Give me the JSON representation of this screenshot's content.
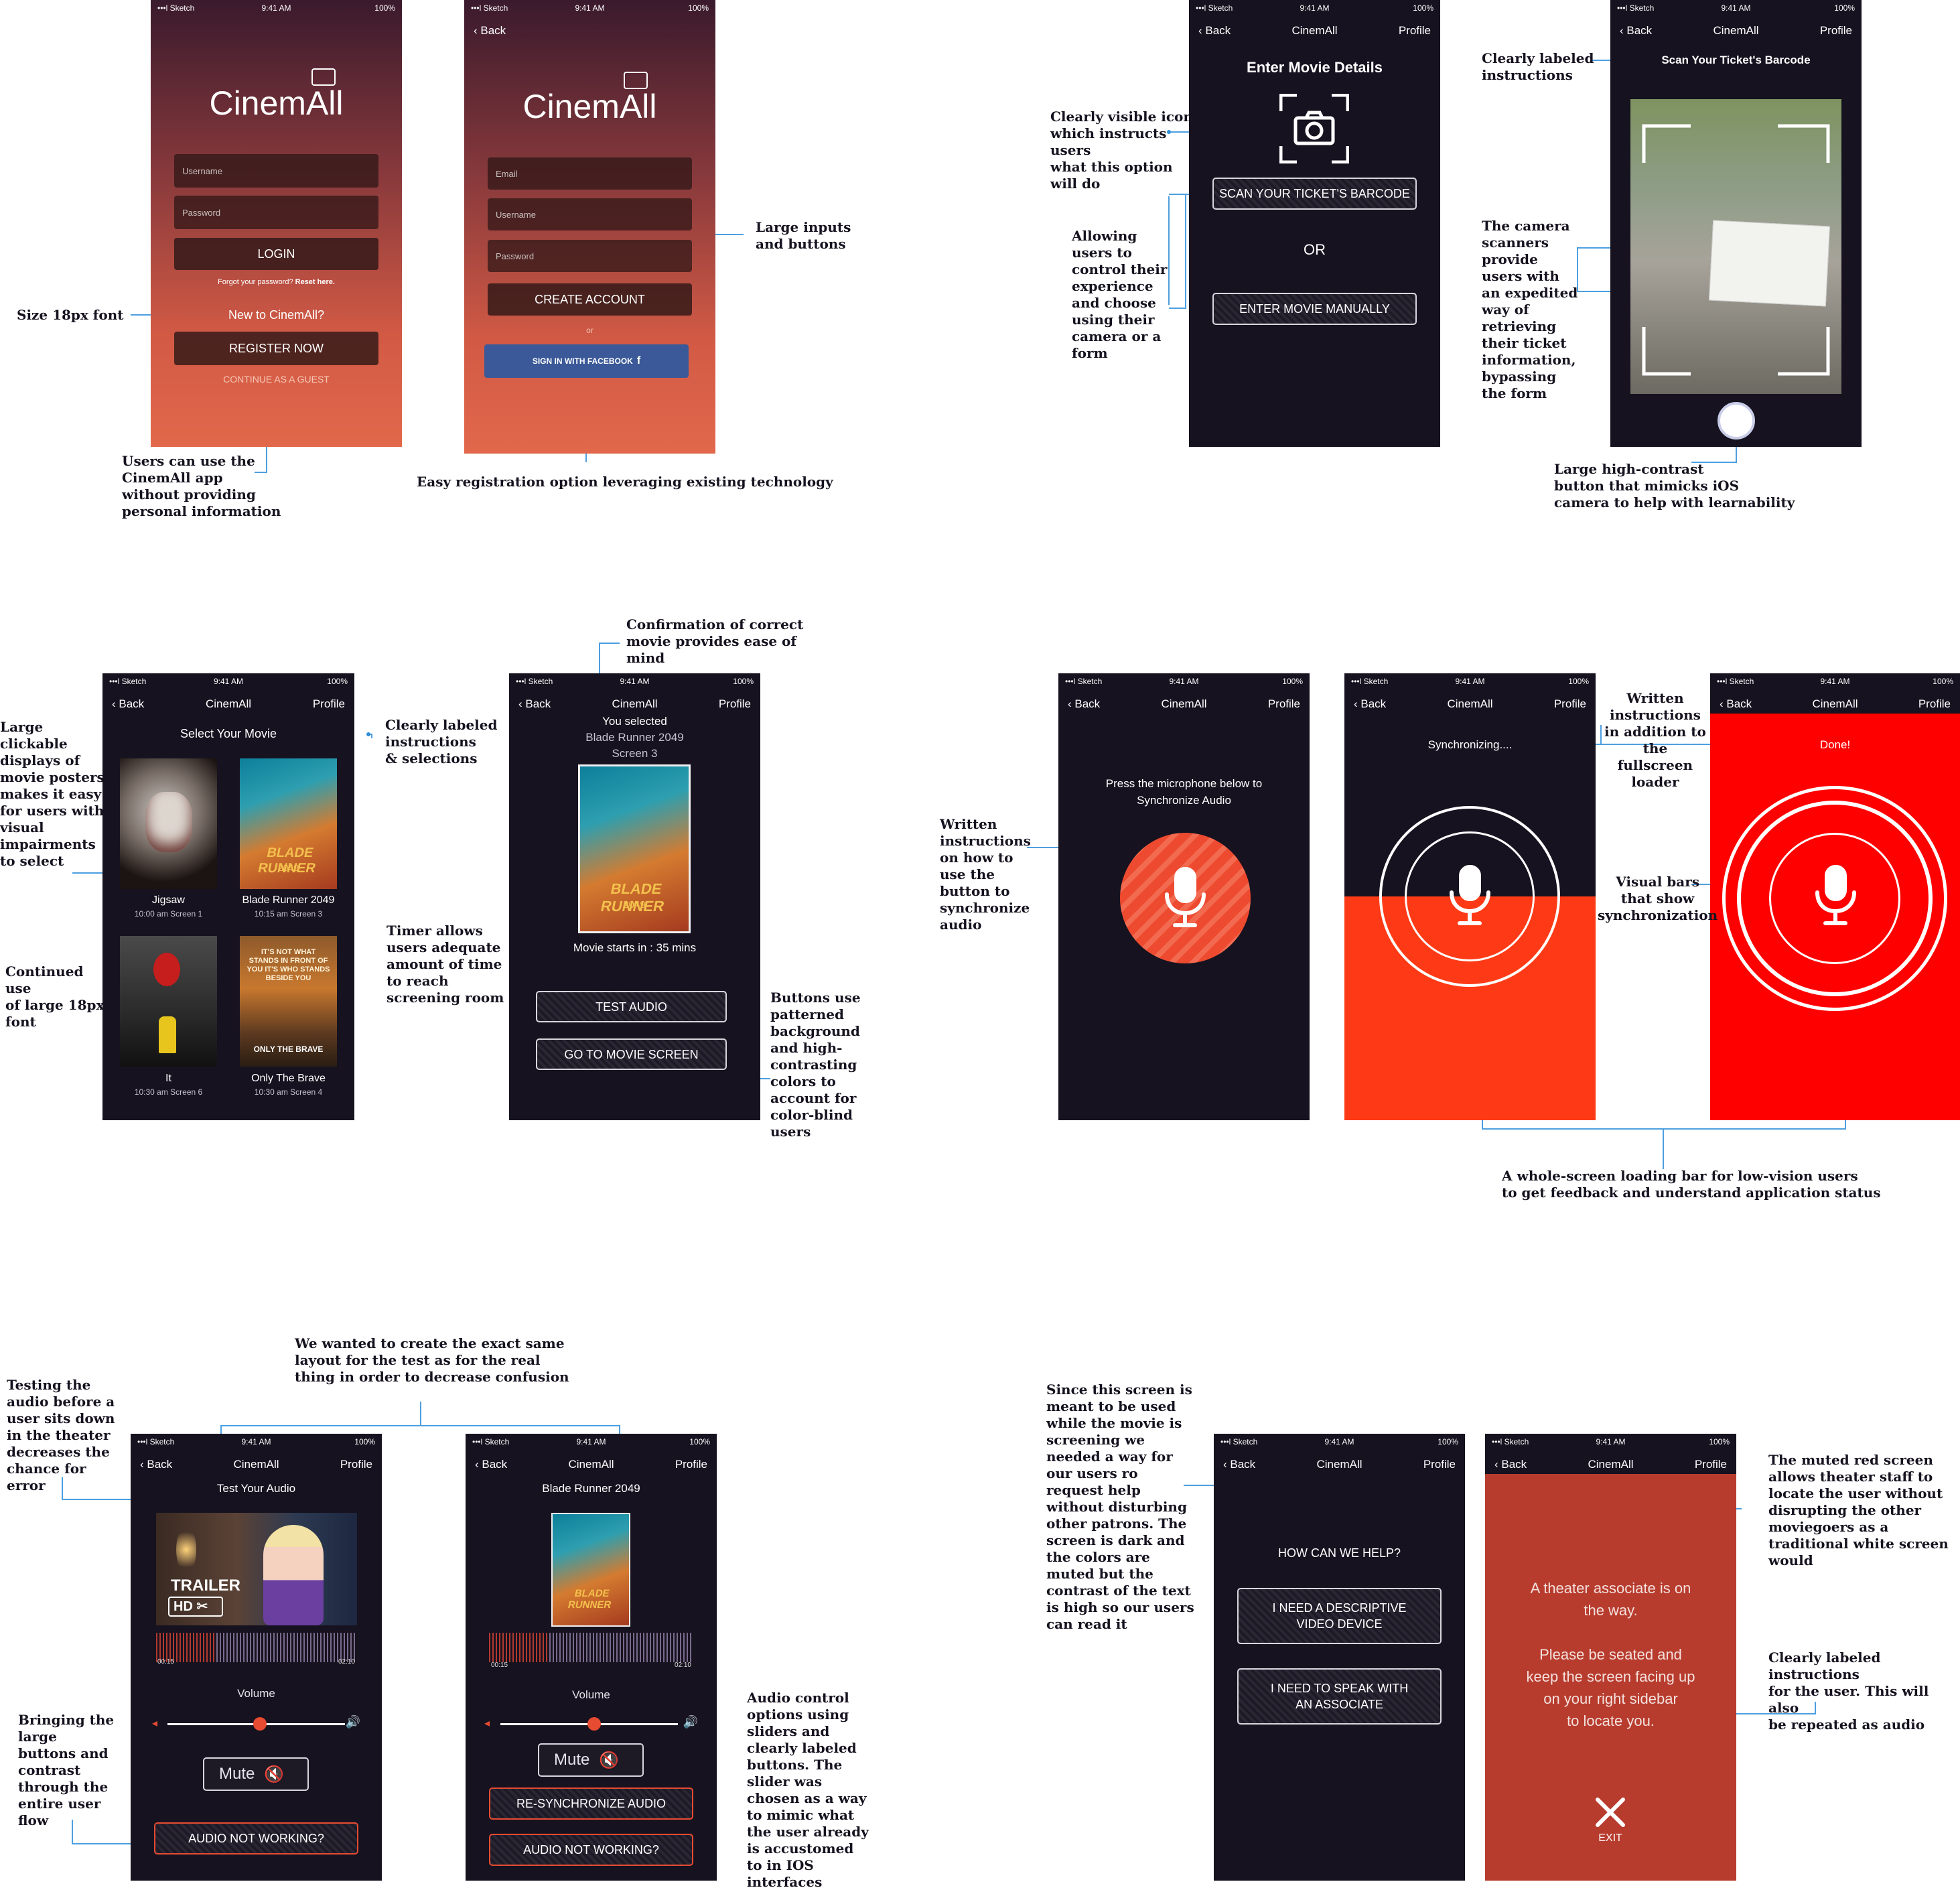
{
  "status": {
    "carrier": "•••l Sketch",
    "time": "9:41 AM",
    "battery": "100%"
  },
  "nav": {
    "back": "Back",
    "title": "CinemAll",
    "profile": "Profile"
  },
  "login": {
    "logo": "CinemAll",
    "username_placeholder": "Username",
    "password_placeholder": "Password",
    "login_button": "LOGIN",
    "forgot": "Forgot your password? ",
    "reset": "Reset here.",
    "new_prompt": "New to CinemAll?",
    "register_button": "REGISTER NOW",
    "guest": "CONTINUE AS A GUEST"
  },
  "register": {
    "logo": "CinemAll",
    "email_placeholder": "Email",
    "username_placeholder": "Username",
    "password_placeholder": "Password",
    "create_button": "CREATE ACCOUNT",
    "or": "or",
    "facebook_button": "SIGN IN WITH FACEBOOK"
  },
  "details": {
    "heading": "Enter Movie Details",
    "scan_button": "SCAN YOUR TICKET'S BARCODE",
    "or": "OR",
    "manual_button": "ENTER MOVIE MANUALLY"
  },
  "scanner": {
    "heading": "Scan Your Ticket's Barcode"
  },
  "select": {
    "heading": "Select Your Movie",
    "movies": [
      {
        "title": "Jigsaw",
        "info": "10:00 am Screen 1"
      },
      {
        "title": "Blade Runner 2049",
        "info": "10:15 am Screen 3"
      },
      {
        "title": "It",
        "info": "10:30 am Screen 6"
      },
      {
        "title": "Only The Brave",
        "info": "10:30 am Screen 4"
      }
    ]
  },
  "selected": {
    "line1": "You selected",
    "movie": "Blade Runner 2049",
    "screen": "Screen 3",
    "starts": "Movie starts in : 35 mins",
    "test_button": "TEST AUDIO",
    "go_button": "GO TO MOVIE SCREEN"
  },
  "sync": {
    "instruction_line1": "Press the microphone below to",
    "instruction_line2": "Synchronize Audio",
    "synchronizing": "Synchronizing....",
    "done": "Done!"
  },
  "test_audio": {
    "heading": "Test Your Audio",
    "time_start": "00:15",
    "time_end": "02:10",
    "volume": "Volume",
    "mute": "Mute",
    "not_working": "AUDIO NOT WORKING?"
  },
  "real_audio": {
    "heading": "Blade Runner 2049",
    "time_start": "00:15",
    "time_end": "02:10",
    "volume": "Volume",
    "mute": "Mute",
    "resync": "RE-SYNCHRONIZE AUDIO",
    "not_working": "AUDIO NOT WORKING?"
  },
  "help": {
    "heading": "HOW CAN WE HELP?",
    "btn1_line1": "I NEED A DESCRIPTIVE",
    "btn1_line2": "VIDEO DEVICE",
    "btn2_line1": "I NEED TO SPEAK WITH",
    "btn2_line2": "AN ASSOCIATE"
  },
  "associate": {
    "line1": "A theater associate is on",
    "line2": "the way.",
    "line3": "Please be seated and",
    "line4": "keep the screen facing up",
    "line5": "on your right sidebar",
    "line6": "to locate you.",
    "exit": "EXIT"
  },
  "poster_text": {
    "blade": "BLADE RUNNER",
    "year": "2049",
    "otb": "IT'S NOT WHAT STANDS IN FRONT OF YOU IT'S WHO STANDS BESIDE YOU",
    "otb_title": "ONLY THE BRAVE",
    "trailer": "TRAILER",
    "hd": "HD"
  },
  "annotations": {
    "size18": "Size 18px font",
    "guest": "Users can use the\nCinemAll app\nwithout providing\npersonal information",
    "large_inputs": "Large inputs\nand buttons",
    "easy_reg": "Easy registration option leveraging existing technology",
    "visible_icon": "Clearly visible icon\nwhich instructs\nusers\nwhat this option\nwill do",
    "allowing": "Allowing\nusers to\ncontrol their\nexperience\nand choose\nusing their\ncamera or a\nform",
    "clearly_labeled": "Clearly labeled\ninstructions",
    "camera_scanners": "The camera\nscanners\nprovide\nusers with\nan expedited\nway of\nretrieving\ntheir ticket\ninformation,\nbypassing\nthe form",
    "shutter": "Large high-contrast\nbutton that mimicks iOS\ncamera to help with learnability",
    "posters": "Large\nclickable\ndisplays of\nmovie posters\nmakes it easy\nfor users with\nvisual\nimpairments\nto select",
    "continued": "Continued\nuse\nof large 18px\nfont",
    "confirmation": "Confirmation of correct\nmovie provides ease of\nmind",
    "labeled_selections": "Clearly labeled\ninstructions\n& selections",
    "timer": "Timer allows\nusers adequate\namount of time\nto reach\nscreening room",
    "patterned": "Buttons use\npatterned\nbackground\nand high-\ncontrasting\ncolors to\naccount for\ncolor-blind\nusers",
    "written_sync": "Written\ninstructions\non how to\nuse the\nbutton to\nsynchronize\naudio",
    "written_loader": "Written\ninstructions\nin addition to\nthe\nfullscreen\nloader",
    "visual_bars": "Visual bars\nthat show\nsynchronization",
    "whole_screen": "A whole-screen loading bar for low-vision users\nto get feedback and understand application status",
    "same_layout": "We wanted to create the exact same\nlayout for the test as for the real\nthing in order to decrease confusion",
    "testing": "Testing the\naudio before a\nuser sits down\nin the theater\ndecreases the\nchance for\nerror",
    "bringing": "Bringing the\nlarge\nbuttons and\ncontrast\nthrough the\nentire user\nflow",
    "audio_control": "Audio control\noptions using\nsliders and\nclearly labeled\nbuttons. The\nslider was\nchosen as a way\nto mimic what\nthe user already\nis accustomed\nto in IOS\ninterfaces",
    "since": "Since this screen is\nmeant to be used\nwhile the movie is\nscreening we\nneeded a way for\nour users ro\nrequest help\nwithout disturbing\nother patrons. The\nscreen is dark and\nthe colors are\nmuted but the\ncontrast of the text\nis high so our users\ncan read it",
    "muted_red": "The muted red screen\nallows theater staff to\nlocate the user without\ndisrupting the other\nmoviegoers as a\ntraditional white screen\nwould",
    "clear_user": "Clearly labeled instructions\nfor the user. This will also\nbe repeated as audio"
  },
  "colors": {
    "dark": "#16121f",
    "accent": "#e74b32",
    "red": "#ff0000",
    "muted_red": "#b83c2e",
    "facebook": "#3b5998",
    "callout": "#2e8fd9"
  }
}
